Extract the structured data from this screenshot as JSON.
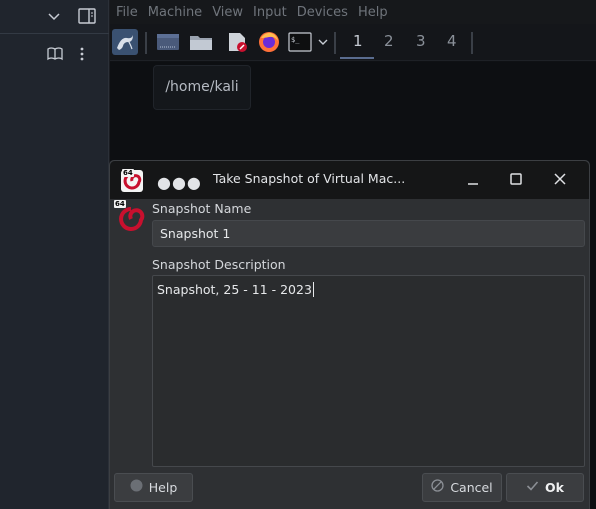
{
  "host_menu": {
    "items": [
      "File",
      "Machine",
      "View",
      "Input",
      "Devices",
      "Help"
    ]
  },
  "taskbar": {
    "workspaces": [
      "1",
      "2",
      "3",
      "4"
    ],
    "active_workspace": "1"
  },
  "tooltip": {
    "text": "/home/kali"
  },
  "dialog": {
    "title": "Take Snapshot of Virtual Mac...",
    "os_badge": "64",
    "snapshot_name_label": "Snapshot Name",
    "snapshot_name_value": "Snapshot 1",
    "snapshot_description_label": "Snapshot Description",
    "snapshot_description_value": "Snapshot, 25 - 11 - 2023",
    "buttons": {
      "help": "Help",
      "cancel": "Cancel",
      "ok": "Ok"
    }
  },
  "colors": {
    "accent": "#5a6c8f",
    "dialog_bg": "#2e3033",
    "kali_red": "#c8102e"
  }
}
